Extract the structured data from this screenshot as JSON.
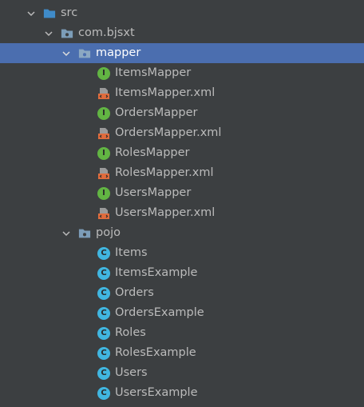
{
  "colors": {
    "background": "#3c3f41",
    "selection": "#4b6eaf",
    "text": "#bbbbbb",
    "interface_badge": "#62b543",
    "class_badge": "#40b6e0",
    "xml_accent": "#e06c3d",
    "folder": "#7c9db8"
  },
  "tree": {
    "src": {
      "label": "src",
      "icon": "source-folder-icon"
    },
    "package": {
      "label": "com.bjsxt",
      "icon": "package-icon"
    },
    "mapper": {
      "label": "mapper",
      "icon": "package-icon",
      "items": [
        {
          "label": "ItemsMapper",
          "kind": "interface",
          "badge": "I"
        },
        {
          "label": "ItemsMapper.xml",
          "kind": "xml"
        },
        {
          "label": "OrdersMapper",
          "kind": "interface",
          "badge": "I"
        },
        {
          "label": "OrdersMapper.xml",
          "kind": "xml"
        },
        {
          "label": "RolesMapper",
          "kind": "interface",
          "badge": "I"
        },
        {
          "label": "RolesMapper.xml",
          "kind": "xml"
        },
        {
          "label": "UsersMapper",
          "kind": "interface",
          "badge": "I"
        },
        {
          "label": "UsersMapper.xml",
          "kind": "xml"
        }
      ]
    },
    "pojo": {
      "label": "pojo",
      "icon": "package-icon",
      "items": [
        {
          "label": "Items",
          "kind": "class",
          "badge": "C"
        },
        {
          "label": "ItemsExample",
          "kind": "class",
          "badge": "C"
        },
        {
          "label": "Orders",
          "kind": "class",
          "badge": "C"
        },
        {
          "label": "OrdersExample",
          "kind": "class",
          "badge": "C"
        },
        {
          "label": "Roles",
          "kind": "class",
          "badge": "C"
        },
        {
          "label": "RolesExample",
          "kind": "class",
          "badge": "C"
        },
        {
          "label": "Users",
          "kind": "class",
          "badge": "C"
        },
        {
          "label": "UsersExample",
          "kind": "class",
          "badge": "C"
        }
      ]
    }
  }
}
